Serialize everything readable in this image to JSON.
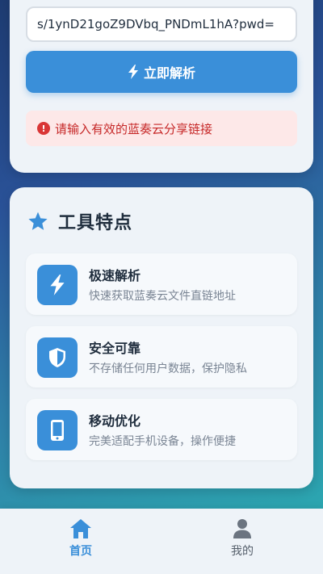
{
  "parse_form": {
    "url_value": "s/1ynD21goZ9DVbq_PNDmL1hA?pwd=",
    "parse_button_label": "立即解析",
    "error_message": "请输入有效的蓝奏云分享链接"
  },
  "features": {
    "title": "工具特点",
    "items": [
      {
        "title": "极速解析",
        "desc": "快速获取蓝奏云文件直链地址",
        "icon": "bolt-icon"
      },
      {
        "title": "安全可靠",
        "desc": "不存储任何用户数据，保护隐私",
        "icon": "shield-icon"
      },
      {
        "title": "移动优化",
        "desc": "完美适配手机设备，操作便捷",
        "icon": "mobile-icon"
      }
    ]
  },
  "bottom_nav": {
    "home_label": "首页",
    "me_label": "我的"
  },
  "colors": {
    "accent": "#3a8fd9",
    "error": "#c62828"
  }
}
